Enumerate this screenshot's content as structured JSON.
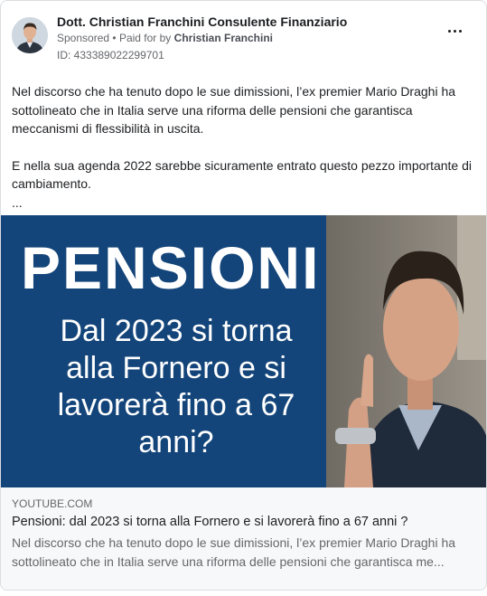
{
  "post": {
    "page_name": "Dott. Christian Franchini Consulente Finanziario",
    "sponsored": "Sponsored",
    "paid_for_prefix": "Paid for by",
    "paid_for_name": "Christian Franchini",
    "ad_id": "ID: 433389022299701",
    "body_line1": "Nel discorso che ha tenuto dopo le sue dimissioni, l’ex premier Mario Draghi ha",
    "body_line2": "sottolineato che in Italia serve una riforma delle pensioni che garantisca",
    "body_line3": "meccanismi di flessibilità in uscita.",
    "body_line4": "E nella sua agenda 2022 sarebbe sicuramente entrato questo pezzo importante di",
    "body_line5": "cambiamento.",
    "body_ellipsis": "..."
  },
  "media": {
    "thumb_title": "PENSIONI",
    "thumb_line1": "Dal 2023 si torna",
    "thumb_line2": "alla Fornero e si",
    "thumb_line3": "lavorerà fino a 67",
    "thumb_line4": "anni?"
  },
  "link": {
    "domain": "YOUTUBE.COM",
    "title": "Pensioni: dal 2023 si torna alla Fornero e si lavorerà fino a 67 anni ?",
    "desc_line1": "Nel discorso che ha tenuto dopo le sue dimissioni, l’ex premier Mario Draghi ha",
    "desc_line2": "sottolineato che in Italia serve una riforma delle pensioni che garantisca me..."
  },
  "colors": {
    "thumb_bg": "#14457a",
    "link_bg": "#f7f8fa",
    "text": "#1c1e21",
    "muted": "#65676b"
  }
}
